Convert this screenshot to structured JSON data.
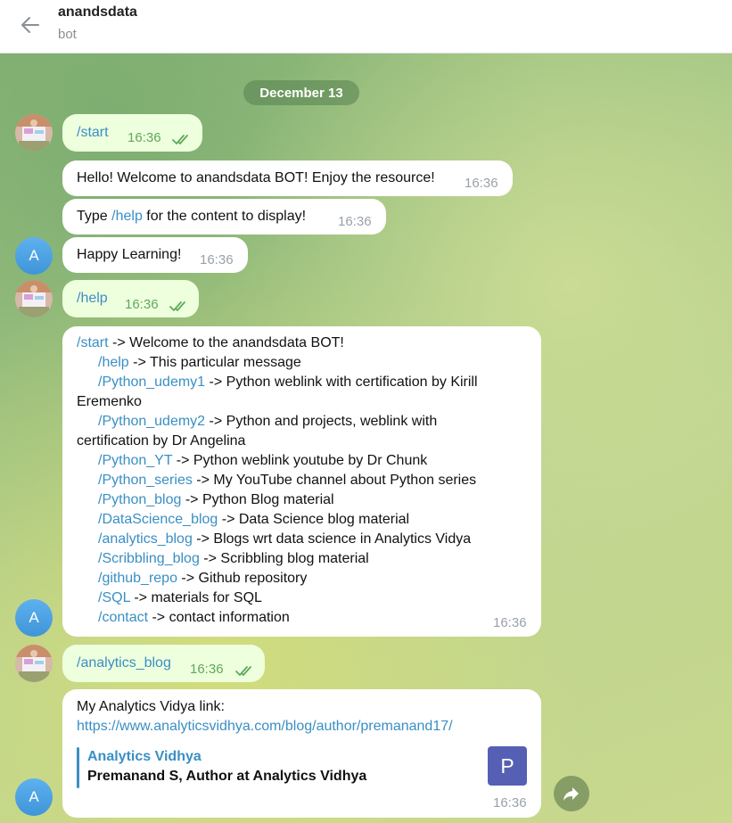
{
  "header": {
    "back_icon": "arrow-left-icon",
    "title": "anandsdata",
    "subtitle": "bot"
  },
  "date_chip": "December 13",
  "messages": {
    "m1": {
      "text": "/start",
      "time": "16:36"
    },
    "m2": {
      "text": "Hello! Welcome to anandsdata BOT! Enjoy the resource!",
      "time": "16:36"
    },
    "m3": {
      "prefix": "Type ",
      "cmd": "/help",
      "suffix": " for the content to display!",
      "time": "16:36"
    },
    "m4": {
      "text": "Happy Learning!",
      "time": "16:36",
      "avatar_letter": "A"
    },
    "m5": {
      "text": "/help",
      "time": "16:36"
    },
    "m6": {
      "time": "16:36",
      "avatar_letter": "A",
      "lines": [
        {
          "cmd": "/start",
          "desc": " -> Welcome to the anandsdata BOT!"
        },
        {
          "cmd": "/help",
          "desc": " -> This particular message"
        },
        {
          "cmd": "/Python_udemy1",
          "desc": " -> Python weblink with certification by Kirill"
        },
        {
          "desc": "Eremenko"
        },
        {
          "cmd": "/Python_udemy2",
          "desc": " -> Python and projects, weblink with"
        },
        {
          "desc": "certification by Dr Angelina"
        },
        {
          "cmd": "/Python_YT",
          "desc": " -> Python weblink youtube by Dr Chunk"
        },
        {
          "cmd": "/Python_series",
          "desc": " -> My YouTube channel about Python series"
        },
        {
          "cmd": "/Python_blog",
          "desc": " -> Python Blog material"
        },
        {
          "cmd": "/DataScience_blog",
          "desc": " -> Data Science blog material"
        },
        {
          "cmd": "/analytics_blog",
          "desc": " -> Blogs wrt data science in Analytics Vidya"
        },
        {
          "cmd": "/Scribbling_blog",
          "desc": " -> Scribbling blog material"
        },
        {
          "cmd": "/github_repo",
          "desc": " -> Github repository"
        },
        {
          "cmd": "/SQL",
          "desc": " -> materials for SQL"
        },
        {
          "cmd": "/contact",
          "desc": " -> contact information"
        }
      ]
    },
    "m7": {
      "text": "/analytics_blog",
      "time": "16:36"
    },
    "m8": {
      "text": "My Analytics Vidya link:",
      "link": "https://www.analyticsvidhya.com/blog/author/premanand17/",
      "preview_site": "Analytics Vidhya",
      "preview_title": "Premanand S, Author at Analytics Vidhya",
      "preview_letter": "P",
      "time": "16:36",
      "avatar_letter": "A"
    }
  },
  "colors": {
    "outgoing_bubble": "#eeffde",
    "incoming_bubble": "#ffffff",
    "link": "#3a8fc4",
    "check": "#5eaa5a"
  },
  "icons": {
    "share": "share-arrow-icon",
    "read_receipt": "double-check-icon"
  }
}
